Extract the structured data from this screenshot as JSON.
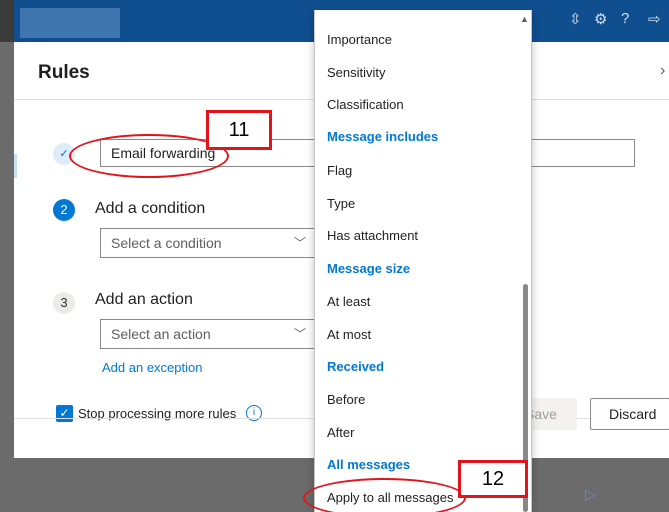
{
  "dialog": {
    "title": "Rules",
    "close_glyph": "›",
    "rule_name_value": "Email forwarding",
    "steps": [
      {
        "number": "✓",
        "label": ""
      },
      {
        "number": "2",
        "label": "Add a condition",
        "placeholder": "Select a condition"
      },
      {
        "number": "3",
        "label": "Add an action",
        "placeholder": "Select an action"
      }
    ],
    "add_exception": "Add an exception",
    "stop_processing_label": "Stop processing more rules",
    "info_glyph": "i",
    "save_label": "Save",
    "discard_label": "Discard"
  },
  "dropdown": {
    "items": [
      {
        "kind": "item",
        "label": "Importance"
      },
      {
        "kind": "item",
        "label": "Sensitivity"
      },
      {
        "kind": "item",
        "label": "Classification"
      },
      {
        "kind": "header",
        "label": "Message includes"
      },
      {
        "kind": "item",
        "label": "Flag"
      },
      {
        "kind": "item",
        "label": "Type"
      },
      {
        "kind": "item",
        "label": "Has attachment"
      },
      {
        "kind": "header",
        "label": "Message size"
      },
      {
        "kind": "item",
        "label": "At least"
      },
      {
        "kind": "item",
        "label": "At most"
      },
      {
        "kind": "header",
        "label": "Received"
      },
      {
        "kind": "item",
        "label": "Before"
      },
      {
        "kind": "item",
        "label": "After"
      },
      {
        "kind": "header",
        "label": "All messages"
      },
      {
        "kind": "item",
        "label": "Apply to all messages"
      }
    ]
  },
  "annotations": {
    "first": "11",
    "second": "12"
  },
  "topbar": {
    "icons": [
      "share-icon",
      "settings-icon",
      "help-icon",
      "send-icon"
    ]
  },
  "colors": {
    "accent": "#0078d4",
    "topbar": "#0f4f8f",
    "annotation": "#e0141a"
  }
}
